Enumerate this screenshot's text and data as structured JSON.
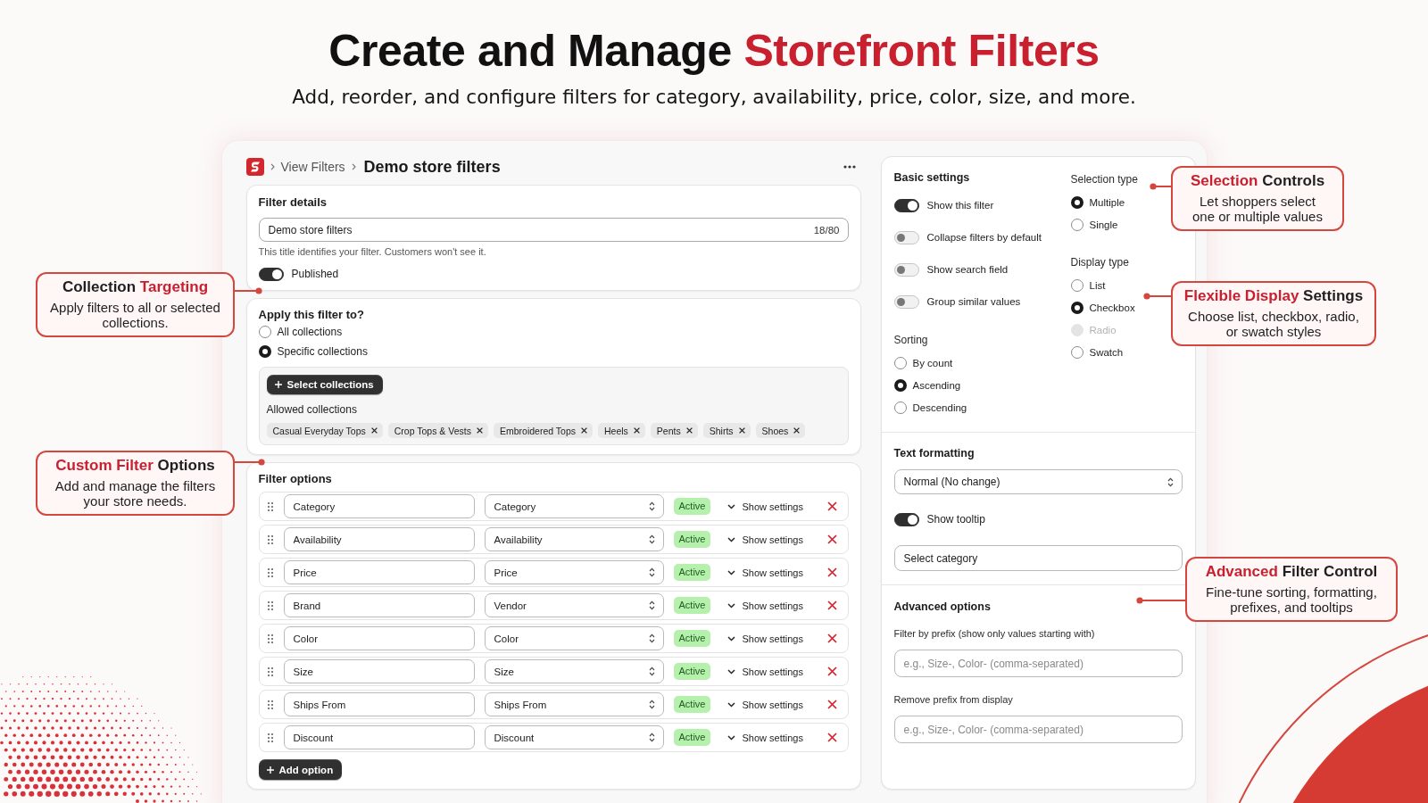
{
  "headline": [
    {
      "text": "Create and Manage",
      "accent": false
    },
    {
      "text": "Storefront Filters",
      "accent": true
    }
  ],
  "subtitle": "Add, reorder, and configure filters for category, availability, price, color, size, and more.",
  "breadcrumb": {
    "parent": "View Filters",
    "current": "Demo store filters"
  },
  "filter_details": {
    "title": "Filter details",
    "name": {
      "value": "Demo store filters",
      "counter": "18/80"
    },
    "help": "This title identifies your filter. Customers won't see it.",
    "published": {
      "label": "Published",
      "on": true
    }
  },
  "apply_to": {
    "title": "Apply this filter to?",
    "options": [
      {
        "label": "All collections",
        "selected": false
      },
      {
        "label": "Specific collections",
        "selected": true
      }
    ],
    "select_button": "Select collections",
    "allowed_label": "Allowed collections",
    "collections": [
      "Casual Everyday Tops",
      "Crop Tops & Vests",
      "Embroidered Tops",
      "Heels",
      "Pents",
      "Shirts",
      "Shoes"
    ]
  },
  "filter_options": {
    "title": "Filter options",
    "rows": [
      {
        "label": "Category",
        "source": "Category",
        "status": "Active",
        "settings": "Show settings"
      },
      {
        "label": "Availability",
        "source": "Availability",
        "status": "Active",
        "settings": "Show settings"
      },
      {
        "label": "Price",
        "source": "Price",
        "status": "Active",
        "settings": "Show settings"
      },
      {
        "label": "Brand",
        "source": "Vendor",
        "status": "Active",
        "settings": "Show settings"
      },
      {
        "label": "Color",
        "source": "Color",
        "status": "Active",
        "settings": "Show settings"
      },
      {
        "label": "Size",
        "source": "Size",
        "status": "Active",
        "settings": "Show settings"
      },
      {
        "label": "Ships From",
        "source": "Ships From",
        "status": "Active",
        "settings": "Show settings"
      },
      {
        "label": "Discount",
        "source": "Discount",
        "status": "Active",
        "settings": "Show settings"
      }
    ],
    "add_button": "Add option"
  },
  "settings_panel": {
    "basic": {
      "title": "Basic settings",
      "toggles": [
        {
          "label": "Show this filter",
          "on": true
        },
        {
          "label": "Collapse filters by default",
          "on": false
        },
        {
          "label": "Show search field",
          "on": false
        },
        {
          "label": "Group similar values",
          "on": false
        }
      ]
    },
    "sorting": {
      "title": "Sorting",
      "options": [
        {
          "label": "By count",
          "selected": false
        },
        {
          "label": "Ascending",
          "selected": true
        },
        {
          "label": "Descending",
          "selected": false
        }
      ]
    },
    "selection_type": {
      "title": "Selection type",
      "options": [
        {
          "label": "Multiple",
          "selected": true
        },
        {
          "label": "Single",
          "selected": false
        }
      ]
    },
    "display_type": {
      "title": "Display type",
      "options": [
        {
          "label": "List",
          "selected": false,
          "disabled": false
        },
        {
          "label": "Checkbox",
          "selected": true,
          "disabled": false
        },
        {
          "label": "Radio",
          "selected": false,
          "disabled": true
        },
        {
          "label": "Swatch",
          "selected": false,
          "disabled": false
        }
      ]
    },
    "text_formatting": {
      "title": "Text formatting",
      "select": "Normal (No change)",
      "tooltip": {
        "label": "Show tooltip",
        "on": true
      },
      "category": "Select category"
    },
    "advanced": {
      "title": "Advanced options",
      "fields": [
        {
          "label": "Filter by prefix (show only values starting with)",
          "placeholder": "e.g., Size-, Color- (comma-separated)"
        },
        {
          "label": "Remove prefix from display",
          "placeholder": "e.g., Size-, Color- (comma-separated)"
        }
      ]
    }
  },
  "callouts": [
    {
      "title": [
        {
          "text": "Collection",
          "accent": false
        },
        {
          "text": "Targeting",
          "accent": true
        }
      ],
      "text": "Apply filters to all or selected collections."
    },
    {
      "title": [
        {
          "text": "Custom Filter",
          "accent": true
        },
        {
          "text": "Options",
          "accent": false
        }
      ],
      "text": "Add and manage the filters your store needs."
    },
    {
      "title": [
        {
          "text": "Selection",
          "accent": true
        },
        {
          "text": "Controls",
          "accent": false
        }
      ],
      "text": "Let shoppers select one or multiple values"
    },
    {
      "title": [
        {
          "text": "Flexible Display",
          "accent": true
        },
        {
          "text": "Settings",
          "accent": false
        }
      ],
      "text": "Choose list, checkbox, radio, or swatch styles"
    },
    {
      "title": [
        {
          "text": "Advanced",
          "accent": true
        },
        {
          "text": "Filter Control",
          "accent": false
        }
      ],
      "text": "Fine-tune sorting, formatting, prefixes, and tooltips"
    }
  ]
}
